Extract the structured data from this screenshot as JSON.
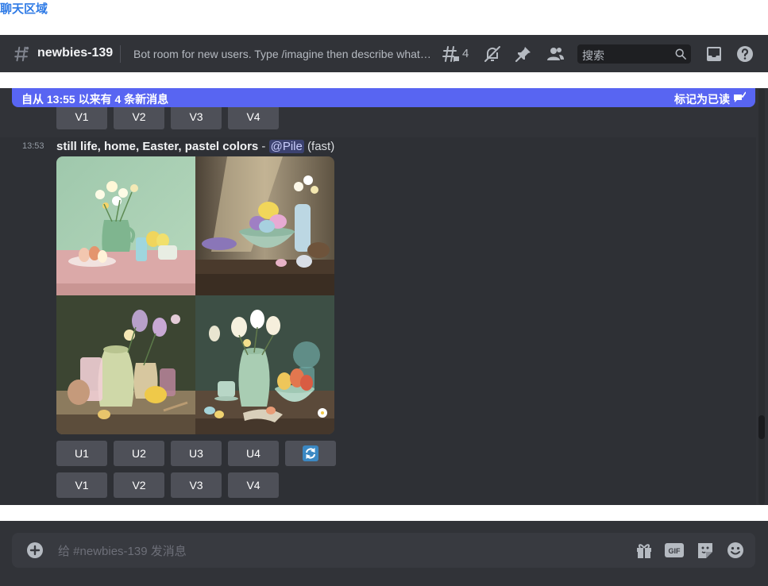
{
  "annotation": {
    "label": "聊天区域"
  },
  "header": {
    "channel_name": "newbies-139",
    "topic": "Bot room for new users. Type /imagine then describe what yo...",
    "thread_count": "4",
    "search_placeholder": "搜索"
  },
  "banner": {
    "text": "自从 13:55 以来有 4 条新消息",
    "mark_read": "标记为已读"
  },
  "previous_message": {
    "buttons": [
      "V1",
      "V2",
      "V3",
      "V4"
    ]
  },
  "message": {
    "timestamp": "13:53",
    "prompt": "still life, home, Easter, pastel colors",
    "separator": " - ",
    "mention": "@Pile",
    "speed": "(fast)",
    "upscale_buttons": [
      "U1",
      "U2",
      "U3",
      "U4"
    ],
    "variation_buttons": [
      "V1",
      "V2",
      "V3",
      "V4"
    ],
    "reroll_icon": "refresh-icon"
  },
  "composer": {
    "placeholder": "给 #newbies-139 发消息"
  },
  "colors": {
    "accent": "#5865f2",
    "background": "#313338",
    "button": "#4e5058",
    "annotation": "#2f7be6"
  }
}
